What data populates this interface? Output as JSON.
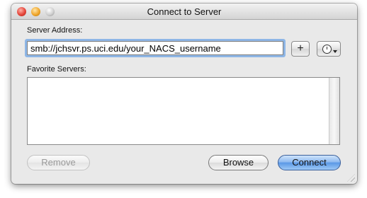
{
  "window": {
    "title": "Connect to Server"
  },
  "server_address": {
    "label": "Server Address:",
    "value": "smb://jchsvr.ps.uci.edu/your_NACS_username",
    "add_label": "+"
  },
  "favorites": {
    "label": "Favorite Servers:",
    "items": []
  },
  "buttons": {
    "remove": "Remove",
    "browse": "Browse",
    "connect": "Connect"
  },
  "icons": {
    "close": "close-button-icon",
    "minimize": "minimize-button-icon",
    "zoom": "zoom-button-icon",
    "recent": "clock-icon",
    "dropdown": "chevron-down-icon",
    "resize": "resize-grip-icon"
  },
  "colors": {
    "accent": "#5b98e6",
    "focus_ring": "#8eb6e6"
  }
}
